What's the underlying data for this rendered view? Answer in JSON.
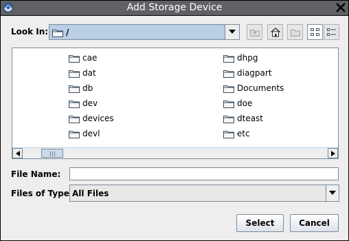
{
  "window": {
    "title": "Add Storage Device",
    "close_glyph": "✕"
  },
  "look_in": {
    "label": "Look In:",
    "value": "/"
  },
  "toolbar": {
    "buttons": [
      {
        "name": "up-folder-button",
        "icon": "up-one-level-icon"
      },
      {
        "name": "home-button",
        "icon": "home-icon"
      },
      {
        "name": "new-folder-button",
        "icon": "new-folder-icon"
      },
      {
        "name": "list-view-button",
        "icon": "list-view-icon",
        "selected": true
      },
      {
        "name": "details-view-button",
        "icon": "details-view-icon",
        "selected": false
      }
    ]
  },
  "files": {
    "column1": [
      "cae",
      "dat",
      "db",
      "dev",
      "devices",
      "devl"
    ],
    "column2": [
      "dhpg",
      "diagpart",
      "Documents",
      "doe",
      "dteast",
      "etc"
    ]
  },
  "file_name": {
    "label": "File Name:",
    "value": "",
    "placeholder": ""
  },
  "files_of_type": {
    "label": "Files of Type:",
    "value": "All Files"
  },
  "buttons": {
    "select": "Select",
    "cancel": "Cancel"
  },
  "colors": {
    "titlebar": "#5f6165",
    "selection_blue": "#b8cfe5",
    "border": "#7a8a99",
    "background": "#eeeeee"
  }
}
